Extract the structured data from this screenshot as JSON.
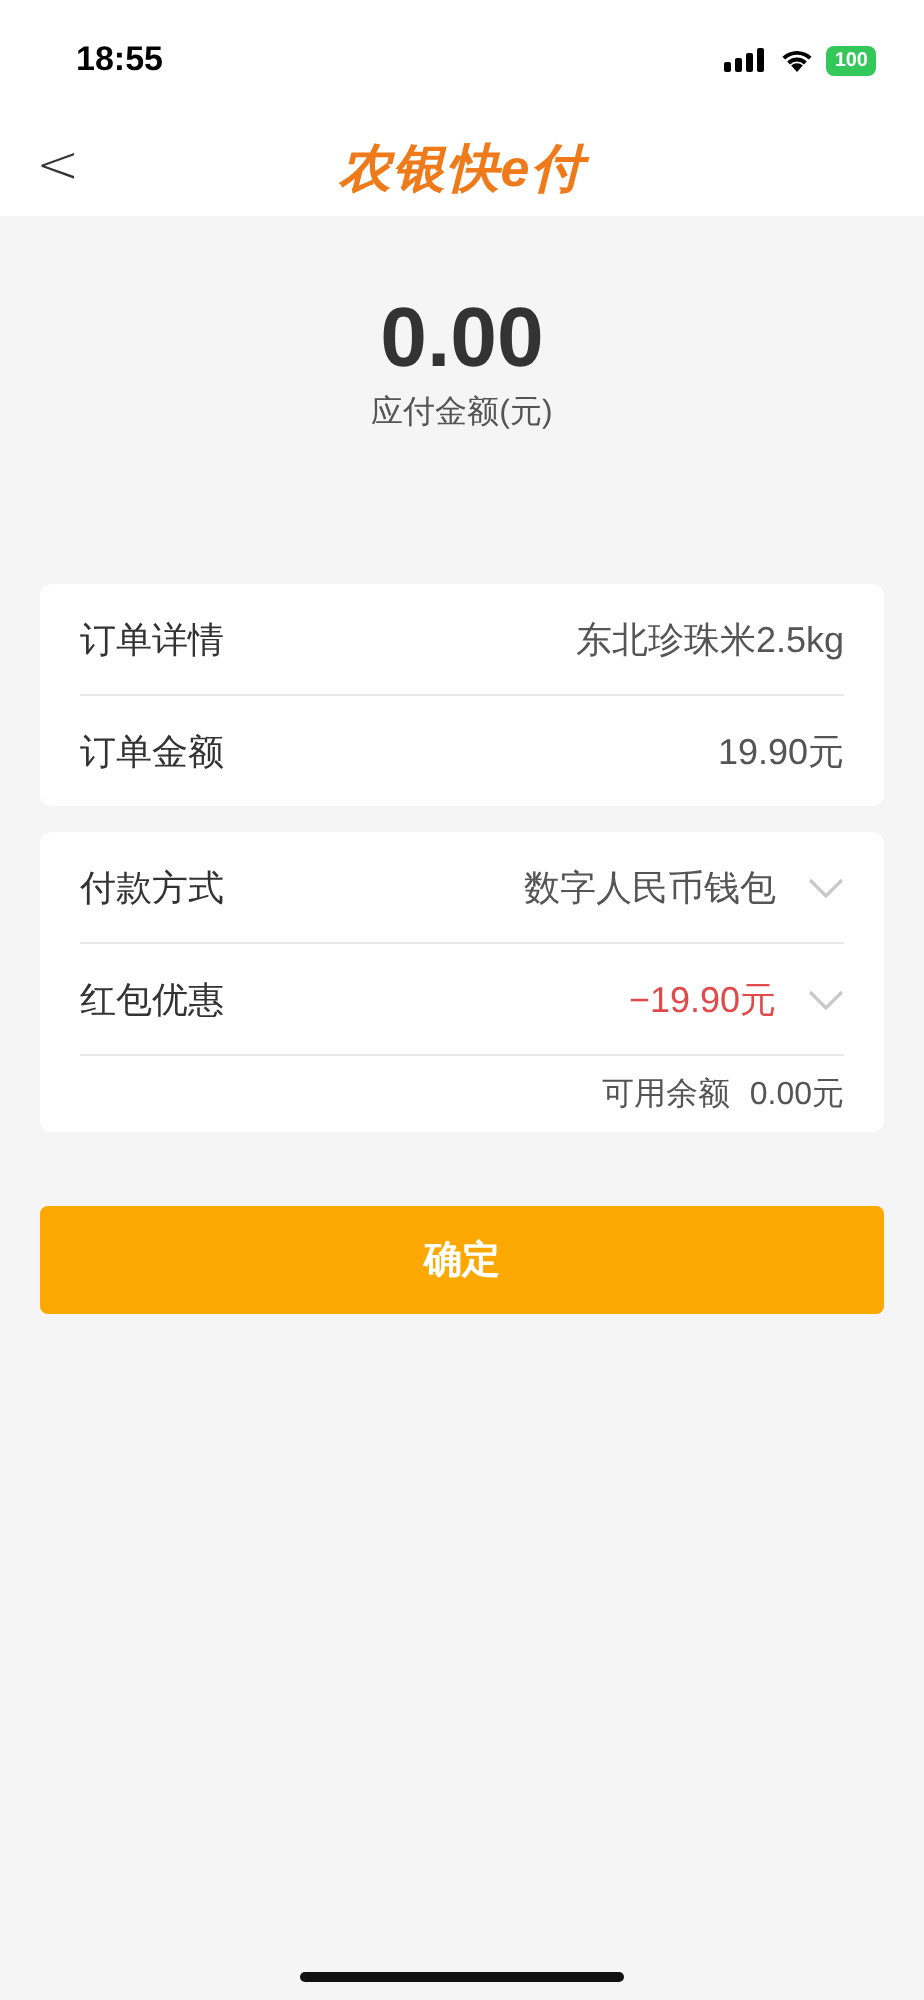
{
  "status_bar": {
    "time": "18:55",
    "battery": "100"
  },
  "header": {
    "back": "<",
    "logo": "农银快e付"
  },
  "amount": {
    "value": "0.00",
    "label": "应付金额(元)"
  },
  "cards": [
    {
      "rows": [
        {
          "kind": "text",
          "label": "订单详情",
          "value": "东北珍珠米2.5kg",
          "negative": false
        },
        {
          "kind": "text",
          "label": "订单金额",
          "value": "19.90元",
          "negative": false
        }
      ]
    },
    {
      "rows": [
        {
          "kind": "select",
          "label": "付款方式",
          "value": "数字人民币钱包",
          "negative": false
        },
        {
          "kind": "select",
          "label": "红包优惠",
          "value": "−19.90元",
          "negative": true
        }
      ],
      "footer": {
        "label": "可用余额",
        "value": "0.00元"
      }
    }
  ],
  "confirm_button": "确定"
}
